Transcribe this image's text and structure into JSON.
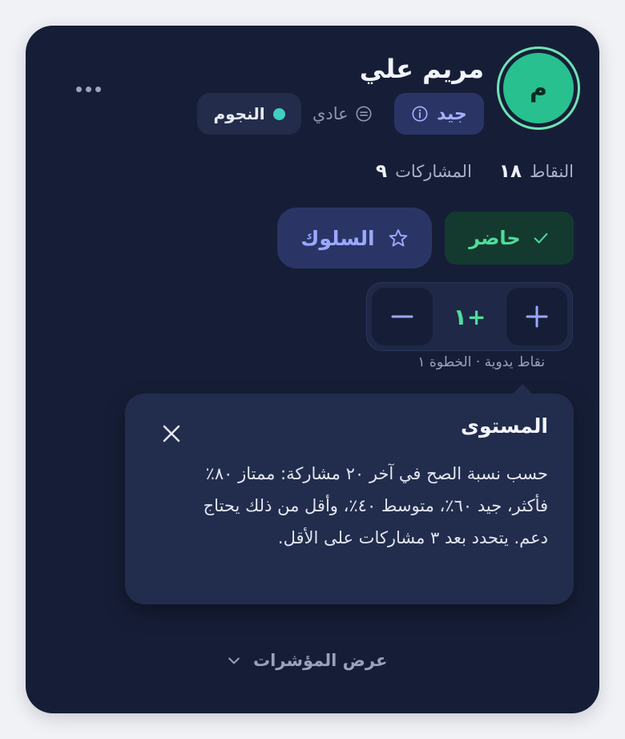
{
  "student": {
    "name": "مريم علي",
    "avatar_initial": "م",
    "level_badge": "جيد",
    "mode_label": "عادي",
    "team": "النجوم"
  },
  "stats": {
    "points_label": "النقاط",
    "points_value": "١٨",
    "participations_label": "المشاركات",
    "participations_value": "٩"
  },
  "actions": {
    "present_label": "حاضر",
    "behavior_label": "السلوك"
  },
  "stepper": {
    "value": "+١",
    "caption": "نقاط يدوية · الخطوة ١"
  },
  "tooltip": {
    "title": "المستوى",
    "body": "حسب نسبة الصح في آخر ٢٠ مشاركة: ممتاز ٨٠٪ فأكثر، جيد ٦٠٪، متوسط ٤٠٪، وأقل من ذلك يحتاج دعم. يتحدد بعد ٣ مشاركات على الأقل."
  },
  "footer": {
    "show_metrics_label": "عرض المؤشرات"
  },
  "colors": {
    "card_bg": "#161e37",
    "accent_green": "#4fdc9b",
    "accent_indigo": "#9aa8ff",
    "team_dot": "#3fd0c0"
  }
}
